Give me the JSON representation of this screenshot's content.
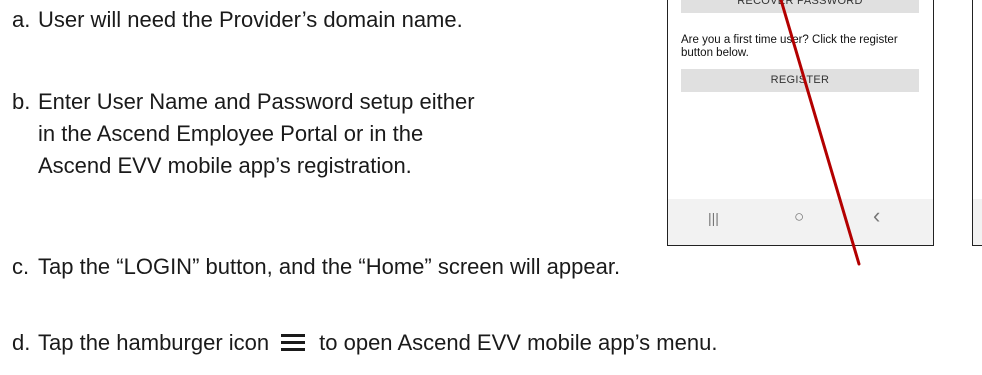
{
  "steps": {
    "a": {
      "marker": "a.",
      "text": "User will need the Provider’s domain name."
    },
    "b": {
      "marker": "b.",
      "lines": [
        "Enter User Name and Password setup either",
        "in the Ascend Employee Portal or in the",
        "Ascend EVV mobile app’s registration."
      ]
    },
    "c": {
      "marker": "c.",
      "text": "Tap the “LOGIN” button, and the “Home” screen will appear."
    },
    "d": {
      "marker": "d.",
      "before": "Tap the hamburger icon",
      "icon": "hamburger-icon",
      "after": "to open Ascend EVV mobile app’s menu."
    }
  },
  "phone_screenshot": {
    "recover_label": "RECOVER PASSWORD",
    "first_time_text": "Are you a first time user? Click the register button below.",
    "register_label": "REGISTER",
    "nav_icons": {
      "recents": "|||",
      "home": "○",
      "back": "‹"
    }
  },
  "colors": {
    "arrow": "#b30000",
    "text": "#1a1a1a",
    "button_bg": "#e0e0e0"
  }
}
